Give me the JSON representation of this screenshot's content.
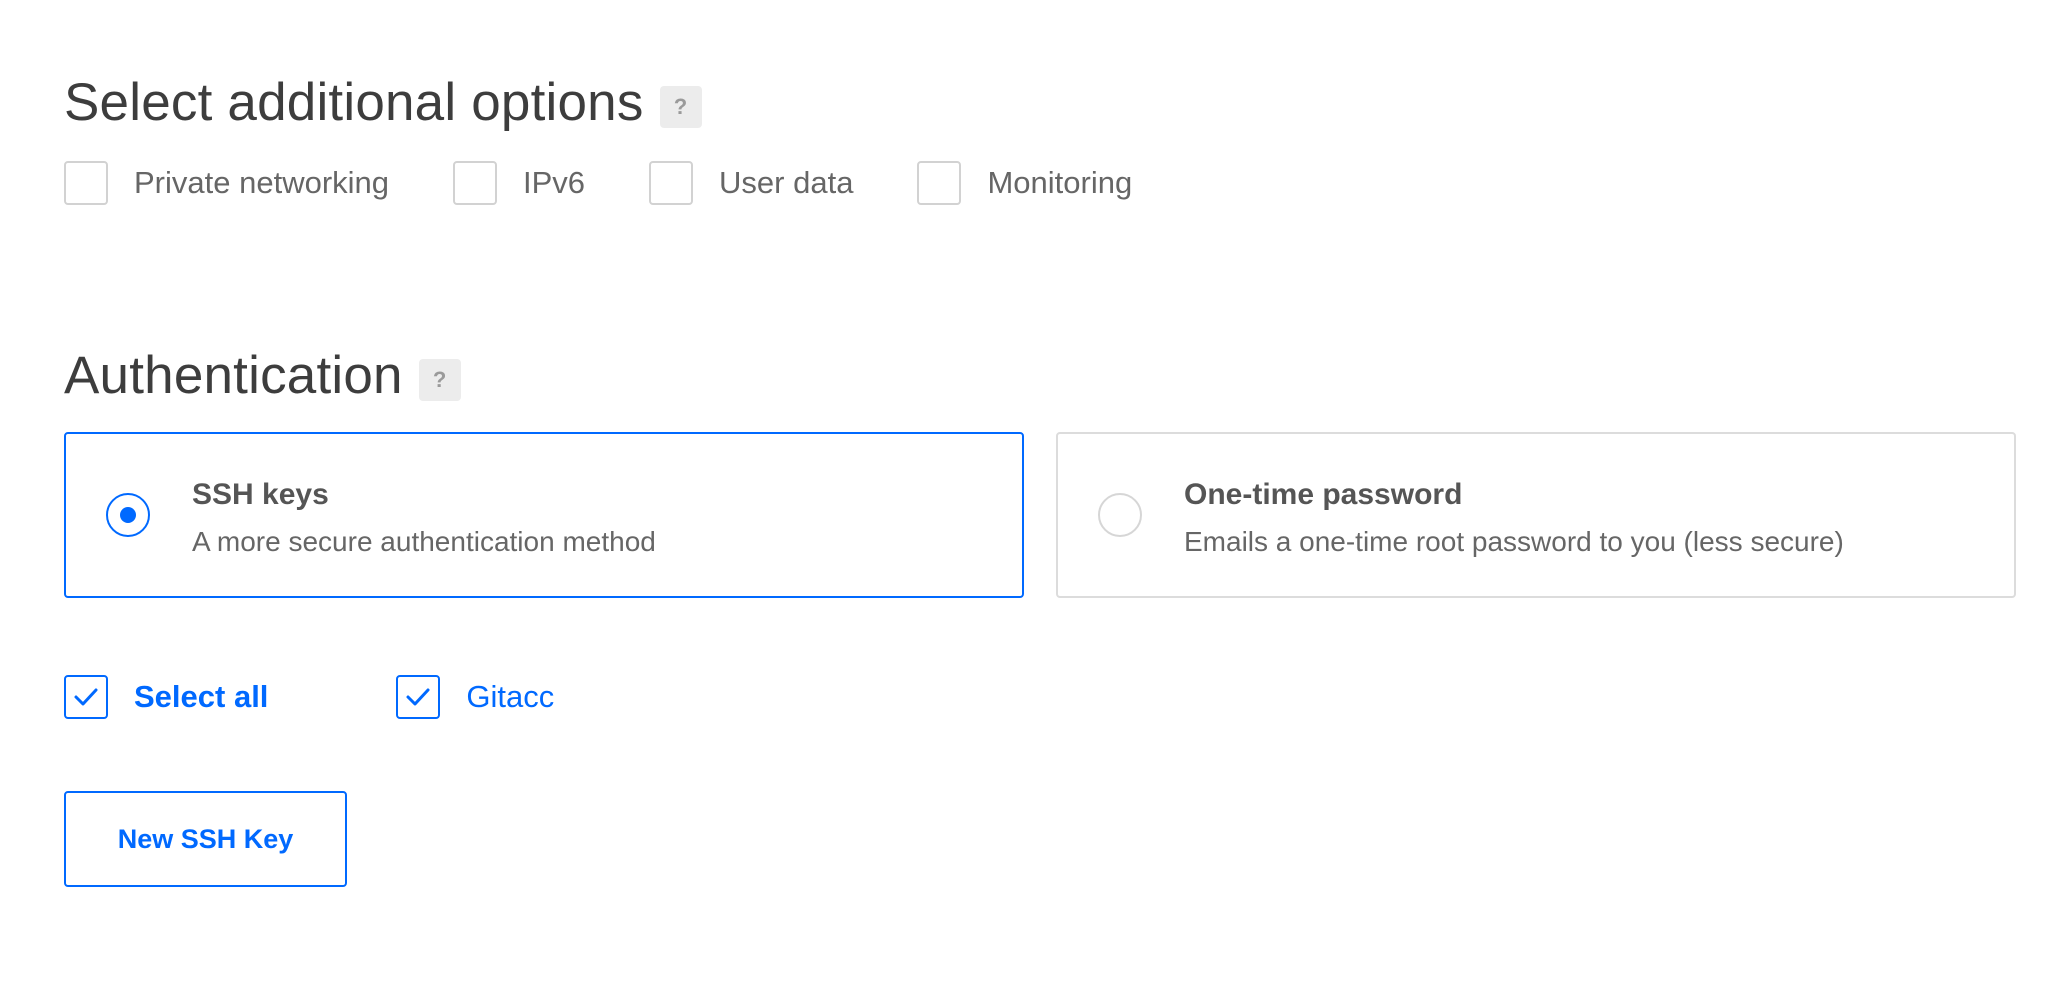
{
  "additional_options": {
    "title": "Select additional options",
    "help": "?",
    "options": [
      {
        "label": "Private networking",
        "checked": false
      },
      {
        "label": "IPv6",
        "checked": false
      },
      {
        "label": "User data",
        "checked": false
      },
      {
        "label": "Monitoring",
        "checked": false
      }
    ]
  },
  "authentication": {
    "title": "Authentication",
    "help": "?",
    "methods": [
      {
        "title": "SSH keys",
        "description": "A more secure authentication method",
        "selected": true
      },
      {
        "title": "One-time password",
        "description": "Emails a one-time root password to you (less secure)",
        "selected": false
      }
    ],
    "keys": {
      "select_all_label": "Select all",
      "select_all_checked": true,
      "items": [
        {
          "label": "Gitacc",
          "checked": true
        }
      ]
    },
    "new_key_button": "New SSH Key"
  },
  "colors": {
    "accent": "#0069ff",
    "text": "#666666",
    "heading": "#3d3d3d",
    "border": "#d2d2d2"
  }
}
